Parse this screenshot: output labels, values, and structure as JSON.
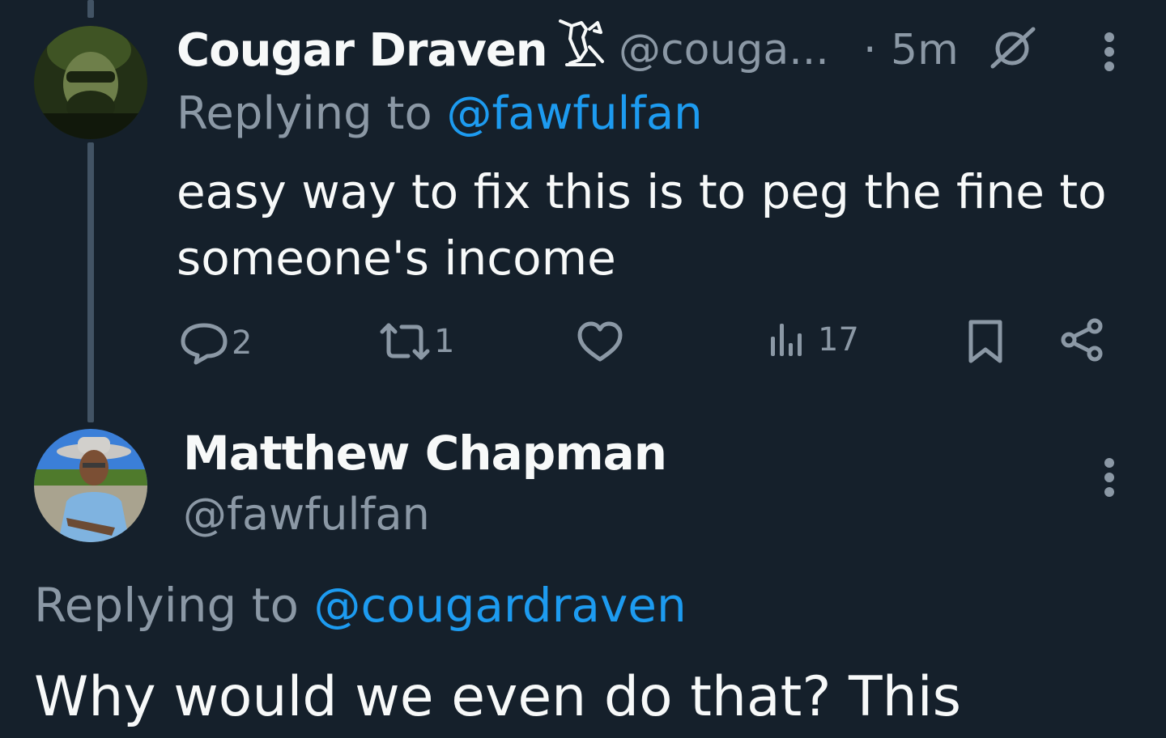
{
  "tweet1": {
    "display_name": "Cougar Draven",
    "handle": "@couga...",
    "separator": "·",
    "time": "5m",
    "replying_prefix": "Replying to",
    "replying_handle": "@fawfulfan",
    "text_line1": "easy way to fix this is to peg the fine to",
    "text_line2": "someone's income",
    "replies_count": "2",
    "retweets_count": "1",
    "views_count": "17",
    "icons": [
      "bird-badge-icon",
      "community-note-icon",
      "more-icon",
      "reply-icon",
      "retweet-icon",
      "like-icon",
      "views-icon",
      "bookmark-icon",
      "share-icon"
    ]
  },
  "tweet2": {
    "display_name": "Matthew Chapman",
    "handle": "@fawfulfan",
    "replying_prefix": "Replying to",
    "replying_handle": "@cougardraven",
    "text_line1": "Why would we even do that? This",
    "icons": [
      "more-icon"
    ]
  },
  "colors": {
    "background": "#15202b",
    "text": "#f7f9f9",
    "muted": "#8b98a5",
    "link": "#1d9bf0",
    "thread_line": "#425364"
  }
}
